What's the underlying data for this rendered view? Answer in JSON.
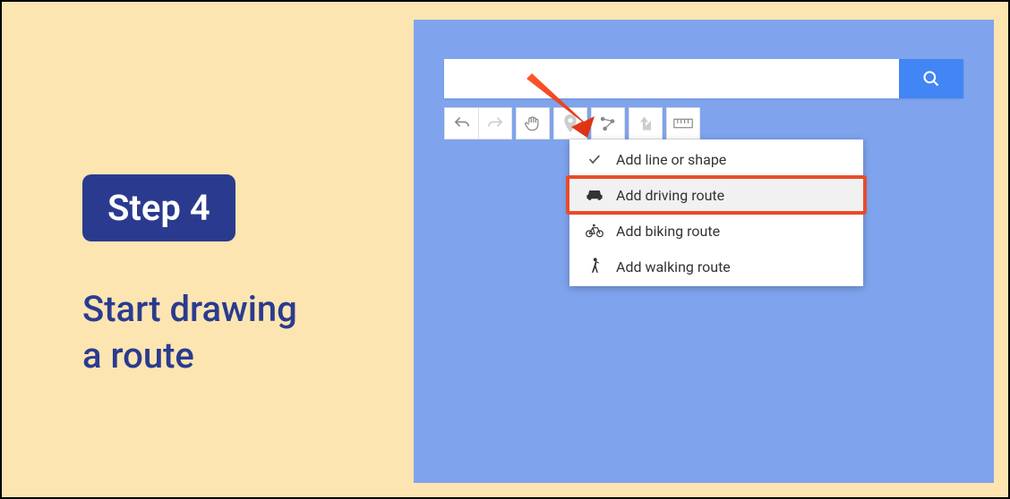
{
  "step": {
    "badge": "Step 4",
    "instruction_line1": "Start drawing",
    "instruction_line2": "a route"
  },
  "search": {
    "value": "",
    "placeholder": ""
  },
  "toolbar": {
    "undo": "undo",
    "redo": "redo",
    "hand": "hand",
    "marker": "marker",
    "draw": "draw-line",
    "directions": "directions",
    "measure": "measure"
  },
  "dropdown": {
    "items": [
      {
        "icon": "check",
        "label": "Add line or shape"
      },
      {
        "icon": "car",
        "label": "Add driving route"
      },
      {
        "icon": "bike",
        "label": "Add biking route"
      },
      {
        "icon": "walk",
        "label": "Add walking route"
      }
    ],
    "highlighted_index": 1
  }
}
